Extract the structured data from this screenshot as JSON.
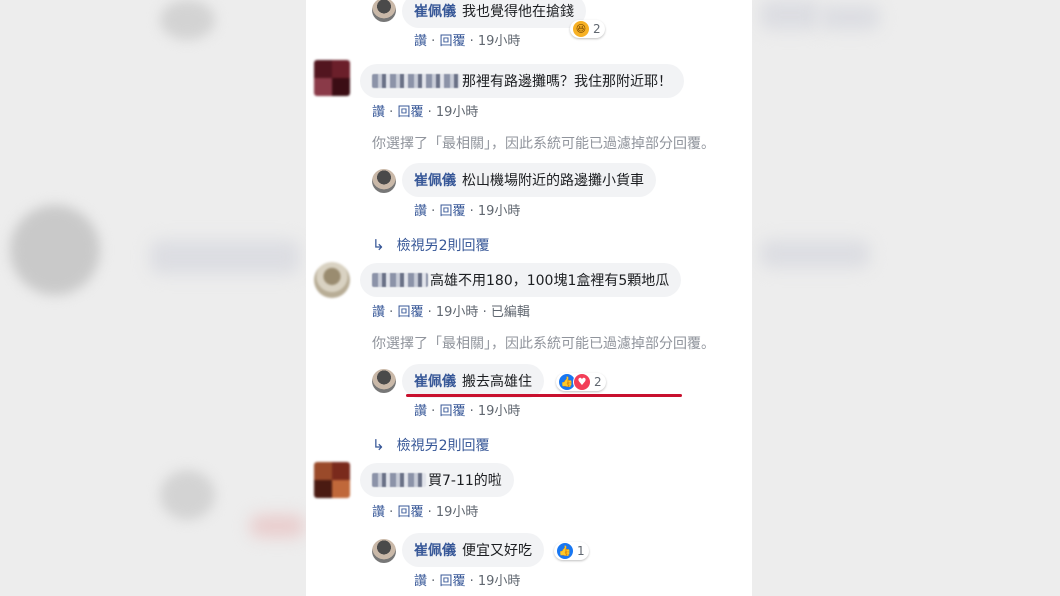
{
  "colors": {
    "link": "#385898",
    "meta": "#606770",
    "bubble": "#f2f3f5",
    "highlight": "#c8102e",
    "like": "#1877f2",
    "love": "#f33e58"
  },
  "comments": [
    {
      "author": "崔佩儀",
      "text": "我也覺得他在搶錢",
      "meta": [
        "讚",
        "回覆",
        "19小時"
      ],
      "reaction": {
        "icons": [
          "haha-icon"
        ],
        "count": "2"
      }
    },
    {
      "author": "",
      "text": "那裡有路邊攤嗎？我住那附近耶！",
      "meta": [
        "讚",
        "回覆",
        "19小時"
      ]
    },
    {
      "author": "崔佩儀",
      "text": "松山機場附近的路邊攤小貨車",
      "meta": [
        "讚",
        "回覆",
        "19小時"
      ]
    },
    {
      "author": "",
      "text": "高雄不用180，100塊1盒裡有5顆地瓜",
      "meta": [
        "讚",
        "回覆",
        "19小時",
        "已編輯"
      ]
    },
    {
      "author": "崔佩儀",
      "text": "搬去高雄住",
      "meta": [
        "讚",
        "回覆",
        "19小時"
      ],
      "reaction": {
        "icons": [
          "like-icon",
          "love-icon"
        ],
        "count": "2"
      }
    },
    {
      "author": "",
      "text": "買7-11的啦",
      "meta": [
        "讚",
        "回覆",
        "19小時"
      ]
    },
    {
      "author": "崔佩儀",
      "text": "便宜又好吃",
      "meta": [
        "讚",
        "回覆",
        "19小時"
      ],
      "reaction": {
        "icons": [
          "like-icon"
        ],
        "count": "1"
      }
    }
  ],
  "notices": [
    "你選擇了「最相關」，因此系統可能已過濾掉部分回覆。",
    "你選擇了「最相關」，因此系統可能已過濾掉部分回覆。"
  ],
  "view_more": [
    "檢視另2則回覆",
    "檢視另2則回覆"
  ],
  "separator": "·"
}
